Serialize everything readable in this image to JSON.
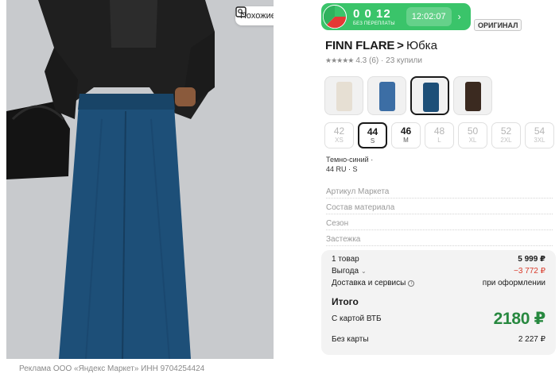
{
  "photo": {
    "similar_label": "Похожие",
    "ad_caption": "Реклама ООО «Яндекс Маркет» ИНН 9704254424"
  },
  "promo": {
    "counter": "0 0 12",
    "caption": "БЕЗ ПЕРЕПЛАТЫ",
    "timer": "12:02:07",
    "chevron": "›",
    "accent": "#3ac46a"
  },
  "original_badge": "ОРИГИНАЛ",
  "product": {
    "brand": "FINN FLARE",
    "chevron": ">",
    "name": "Юбка",
    "stars": "★★★★★",
    "rating": "4.3 (6) · 23 купили"
  },
  "colors": [
    {
      "name": "swatch-beige",
      "color": "#e6dfd3",
      "selected": false
    },
    {
      "name": "swatch-light-blue",
      "color": "#3c6ea5",
      "selected": false
    },
    {
      "name": "swatch-dark-blue",
      "color": "#1d4f78",
      "selected": true
    },
    {
      "name": "swatch-brown",
      "color": "#3b2a20",
      "selected": false
    }
  ],
  "sizes": [
    {
      "n": "42",
      "l": "XS",
      "avail": false,
      "selected": false
    },
    {
      "n": "44",
      "l": "S",
      "avail": true,
      "selected": true
    },
    {
      "n": "46",
      "l": "M",
      "avail": true,
      "selected": false
    },
    {
      "n": "48",
      "l": "L",
      "avail": false,
      "selected": false
    },
    {
      "n": "50",
      "l": "XL",
      "avail": false,
      "selected": false
    },
    {
      "n": "52",
      "l": "2XL",
      "avail": false,
      "selected": false
    },
    {
      "n": "54",
      "l": "3XL",
      "avail": false,
      "selected": false
    }
  ],
  "selection": {
    "color": "Темно-синий ·",
    "size": "44 RU · S"
  },
  "specs": [
    "Артикул Маркета",
    "Состав материала",
    "Сезон",
    "Застежка"
  ],
  "cart": {
    "items_label": "1 товар",
    "items_value": "5 999 ₽",
    "benefit_label": "Выгода",
    "benefit_dropdown": "⌄",
    "benefit_value": "−3 772 ₽",
    "delivery_label": "Доставка и сервисы",
    "delivery_info": "i",
    "delivery_value": "при оформлении",
    "total_title": "Итого",
    "vtb_label": "С картой ВТБ",
    "vtb_value": "2180 ₽",
    "nocard_label": "Без карты",
    "nocard_value": "2 227 ₽",
    "price_color": "#27883f",
    "discount_color": "#d93a2a"
  }
}
